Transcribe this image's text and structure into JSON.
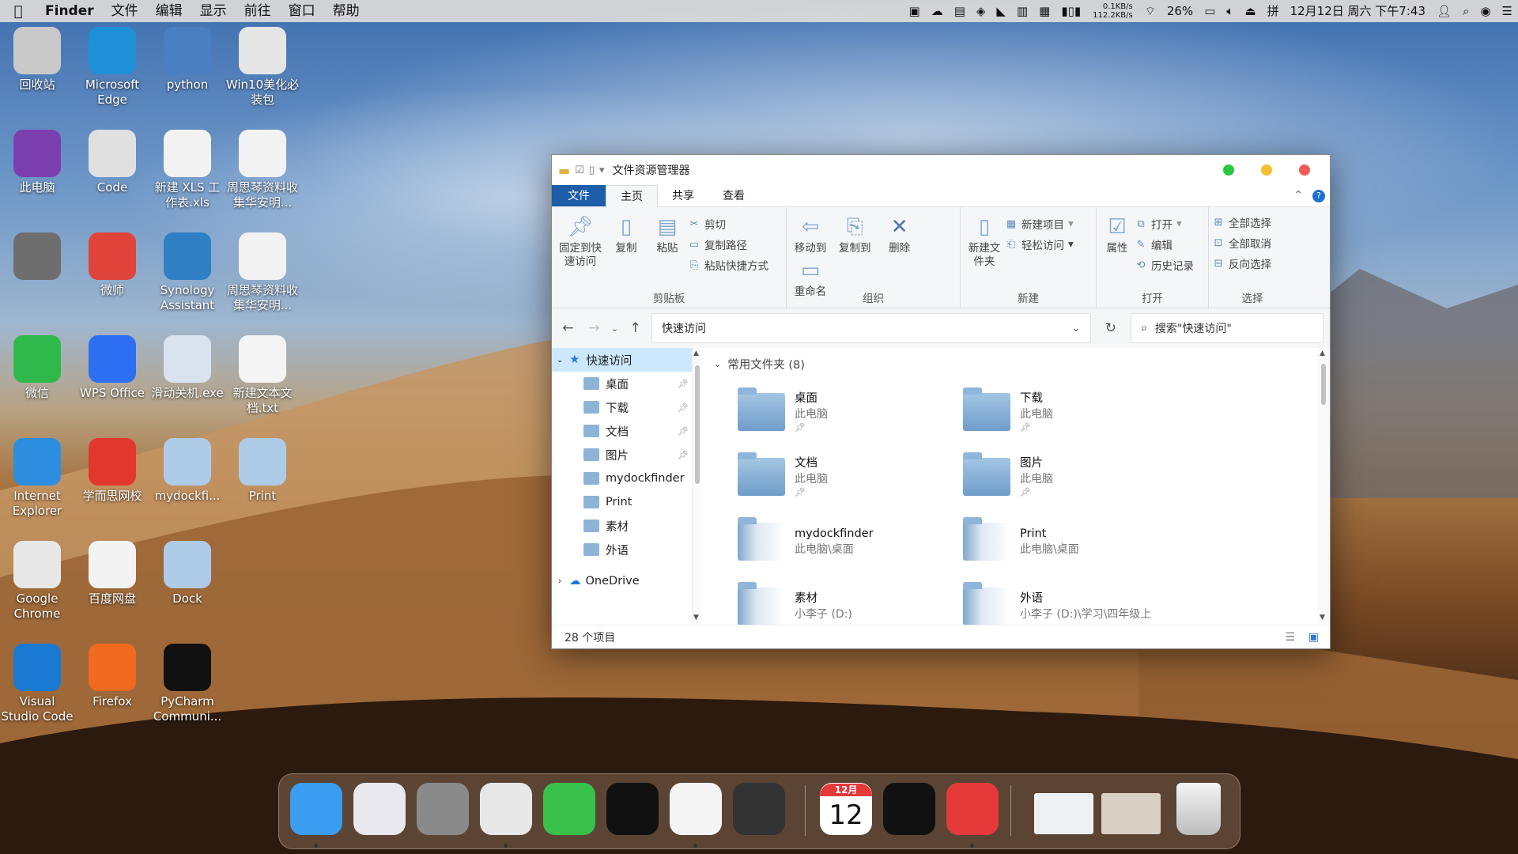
{
  "menubar": {
    "app_name": "Finder",
    "menus": [
      "文件",
      "编辑",
      "显示",
      "前往",
      "窗口",
      "帮助"
    ],
    "net_up": "0.1KB/s",
    "net_down": "112.2KB/s",
    "battery": "26%",
    "ime": "拼",
    "datetime": "12月12日 周六 下午7:43"
  },
  "desktop": {
    "icons": [
      {
        "label": "回收站",
        "color": "#c9c9c9"
      },
      {
        "label": "Microsoft Edge",
        "color": "#1f8fd8"
      },
      {
        "label": "python",
        "color": "#4a7fc1"
      },
      {
        "label": "Win10美化必装包",
        "color": "#e6e6e6"
      },
      {
        "label": "此电脑",
        "color": "#7b3fb0"
      },
      {
        "label": "Code",
        "color": "#e0e0e0"
      },
      {
        "label": "新建 XLS 工作表.xls",
        "color": "#f2f2f2"
      },
      {
        "label": "周思琴资料收集华安明...",
        "color": "#f2f2f2"
      },
      {
        "label": "",
        "color": "#6e6e6e"
      },
      {
        "label": "微师",
        "color": "#e0433a"
      },
      {
        "label": "Synology Assistant",
        "color": "#2e7fc4"
      },
      {
        "label": "周思琴资料收集华安明...",
        "color": "#f2f2f2"
      },
      {
        "label": "微信",
        "color": "#2fb94a"
      },
      {
        "label": "WPS Office",
        "color": "#2d6ff0"
      },
      {
        "label": "滑动关机.exe",
        "color": "#d9e3ef"
      },
      {
        "label": "新建文本文档.txt",
        "color": "#f4f4f4"
      },
      {
        "label": "Internet Explorer",
        "color": "#2d8ee0"
      },
      {
        "label": "学而思网校",
        "color": "#e2372d"
      },
      {
        "label": "mydockfi...",
        "color": "#aecbe8"
      },
      {
        "label": "Print",
        "color": "#aecbe8"
      },
      {
        "label": "Google Chrome",
        "color": "#e8e8e8"
      },
      {
        "label": "百度网盘",
        "color": "#f3f3f3"
      },
      {
        "label": "Dock",
        "color": "#aecbe8"
      },
      {
        "label": "",
        "color": "transparent"
      },
      {
        "label": "Visual Studio Code",
        "color": "#1a7ad3"
      },
      {
        "label": "Firefox",
        "color": "#f06a1f"
      },
      {
        "label": "PyCharm Communi...",
        "color": "#111111"
      }
    ]
  },
  "explorer": {
    "title": "文件资源管理器",
    "tabs": [
      "文件",
      "主页",
      "共享",
      "查看"
    ],
    "ribbon": {
      "clipboard": {
        "pin": "固定到快速访问",
        "copy": "复制",
        "paste": "粘贴",
        "cut": "剪切",
        "copy_path": "复制路径",
        "paste_shortcut": "粘贴快捷方式",
        "label": "剪贴板"
      },
      "organize": {
        "move_to": "移动到",
        "copy_to": "复制到",
        "delete": "删除",
        "rename": "重命名",
        "label": "组织"
      },
      "new": {
        "new_folder": "新建文件夹",
        "new_item": "新建项目",
        "easy_access": "轻松访问",
        "label": "新建"
      },
      "open": {
        "properties": "属性",
        "open": "打开",
        "edit": "编辑",
        "history": "历史记录",
        "label": "打开"
      },
      "select": {
        "select_all": "全部选择",
        "select_none": "全部取消",
        "invert": "反向选择",
        "label": "选择"
      }
    },
    "address": "快速访问",
    "search_placeholder": "搜索\"快速访问\"",
    "nav": {
      "quick_access": "快速访问",
      "items": [
        "桌面",
        "下载",
        "文档",
        "图片",
        "mydockfinder",
        "Print",
        "素材",
        "外语"
      ],
      "onedrive": "OneDrive"
    },
    "section_title": "常用文件夹 (8)",
    "tiles": [
      {
        "name": "桌面",
        "loc": "此电脑"
      },
      {
        "name": "下载",
        "loc": "此电脑"
      },
      {
        "name": "文档",
        "loc": "此电脑"
      },
      {
        "name": "图片",
        "loc": "此电脑"
      },
      {
        "name": "mydockfinder",
        "loc": "此电脑\\桌面"
      },
      {
        "name": "Print",
        "loc": "此电脑\\桌面"
      },
      {
        "name": "素材",
        "loc": "小李子 (D:)"
      },
      {
        "name": "外语",
        "loc": "小李子 (D:)\\学习\\四年级上"
      }
    ],
    "status": "28 个项目"
  },
  "dock": {
    "apps": [
      {
        "name": "Finder",
        "color": "#3a9df0"
      },
      {
        "name": "Launchpad",
        "color": "#e8e8ee"
      },
      {
        "name": "System Preferences",
        "color": "#8a8a8a"
      },
      {
        "name": "Chrome",
        "color": "#e8e8e8"
      },
      {
        "name": "WeChat",
        "color": "#39c24b"
      },
      {
        "name": "PyCharm",
        "color": "#111111"
      },
      {
        "name": "Scissors",
        "color": "#f4f4f4"
      },
      {
        "name": "Terminal",
        "color": "#333333"
      },
      {
        "name": "Calendar",
        "color": "#ffffff"
      },
      {
        "name": "Clock",
        "color": "#111111"
      },
      {
        "name": "Vivaldi",
        "color": "#e5393a"
      }
    ],
    "calendar_month": "12月",
    "calendar_day": "12"
  }
}
